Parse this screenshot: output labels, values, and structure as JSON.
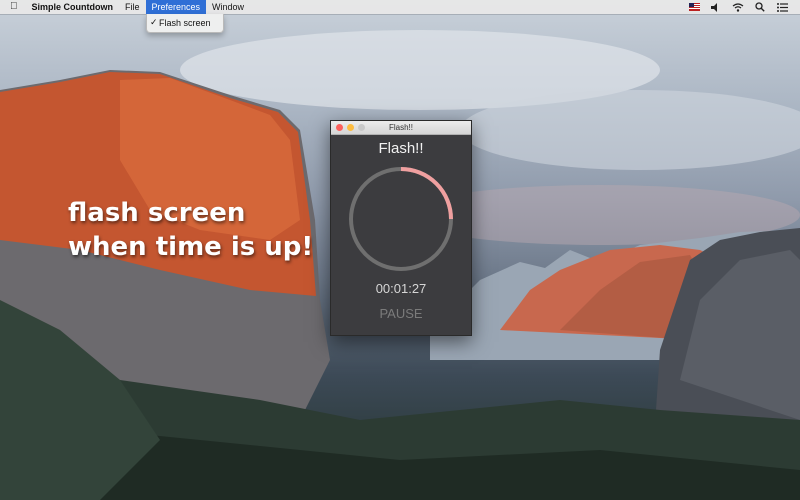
{
  "menubar": {
    "app_name": "Simple Countdown",
    "menus": [
      "File",
      "Preferences",
      "Window"
    ],
    "active_menu": "Preferences"
  },
  "dropdown": {
    "items": [
      {
        "label": "Flash screen",
        "checked": true
      }
    ]
  },
  "caption": {
    "line1": "flash screen",
    "line2": "when time is up!"
  },
  "window": {
    "title": "Flash!!",
    "heading": "Flash!!",
    "time": "00:01:27",
    "pause_label": "PAUSE",
    "progress_fraction": 0.25
  },
  "colors": {
    "progress": "#f0a0a0",
    "track": "#6f6f6f",
    "window_bg": "#3c3c3f",
    "menu_highlight": "#2f6fd6"
  },
  "icons": [
    "apple-icon",
    "flag-icon",
    "volume-icon",
    "wifi-icon",
    "search-icon",
    "list-icon"
  ]
}
